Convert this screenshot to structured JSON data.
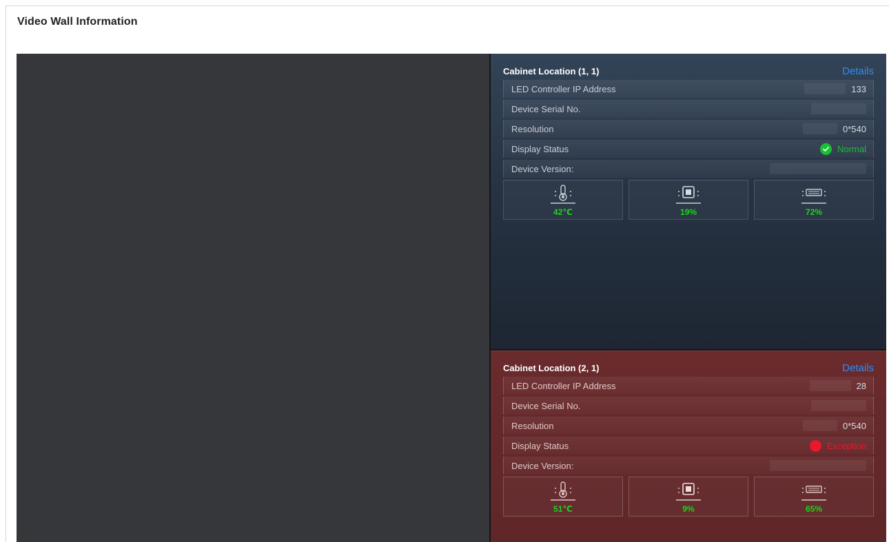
{
  "page": {
    "title": "Video Wall Information"
  },
  "colors": {
    "accent_link": "#2d8cf0",
    "normal": "#19c034",
    "exception": "#e8192c",
    "metric_value": "#1ed41e"
  },
  "cabinets": [
    {
      "title": "Cabinet Location (1, 1)",
      "details_label": "Details",
      "rows": {
        "ip": {
          "label": "LED Controller IP Address",
          "value": "133"
        },
        "serial": {
          "label": "Device Serial No.",
          "value": ""
        },
        "res": {
          "label": "Resolution",
          "value": "0*540"
        },
        "status": {
          "label": "Display Status",
          "value": "Normal",
          "icon": "check-circle-icon"
        },
        "version": {
          "label": "Device Version:",
          "value": ""
        }
      },
      "metrics": {
        "temperature": {
          "icon": "thermometer-icon",
          "value": "42℃"
        },
        "cpu": {
          "icon": "chip-icon",
          "value": "19%"
        },
        "memory": {
          "icon": "memory-icon",
          "value": "72%"
        }
      }
    },
    {
      "title": "Cabinet Location (2, 1)",
      "details_label": "Details",
      "rows": {
        "ip": {
          "label": "LED Controller IP Address",
          "value": "28"
        },
        "serial": {
          "label": "Device Serial No.",
          "value": ""
        },
        "res": {
          "label": "Resolution",
          "value": "0*540"
        },
        "status": {
          "label": "Display Status",
          "value": "Exception",
          "icon": "error-dot-icon"
        },
        "version": {
          "label": "Device Version:",
          "value": ""
        }
      },
      "metrics": {
        "temperature": {
          "icon": "thermometer-icon",
          "value": "51℃"
        },
        "cpu": {
          "icon": "chip-icon",
          "value": "9%"
        },
        "memory": {
          "icon": "memory-icon",
          "value": "65%"
        }
      }
    }
  ]
}
